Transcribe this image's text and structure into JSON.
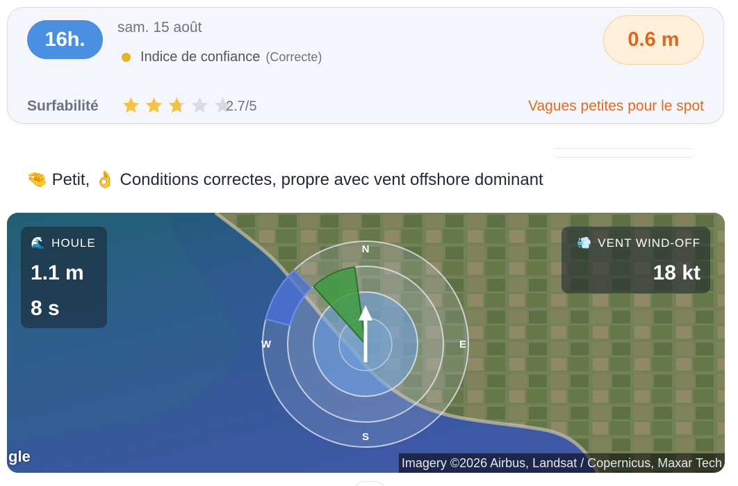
{
  "forecast": {
    "hour": "16h.",
    "date": "sam. 15 août",
    "confidence_label": "Indice de confiance",
    "confidence_level": "(Correcte)",
    "wave_height": "0.6 m",
    "surfability_label": "Surfabilité",
    "surfability_rating": 2.7,
    "surfability_score": "2.7/5",
    "warning": "Vagues petites pour le spot"
  },
  "summary": {
    "emoji_size": "🤏",
    "size_text": "Petit,",
    "emoji_quality": "👌",
    "conditions_text": "Conditions correctes, propre avec vent offshore dominant"
  },
  "map": {
    "swell": {
      "icon": "wave-icon",
      "emoji": "🌊",
      "label": "HOULE",
      "height": "1.1 m",
      "period": "8 s",
      "direction_deg": 300
    },
    "wind": {
      "icon": "wind-icon",
      "emoji": "💨",
      "label": "VENT WIND-OFF",
      "speed": "18 kt",
      "direction_deg": 335
    },
    "compass": {
      "north": "N",
      "east": "E",
      "south": "S",
      "west": "W"
    },
    "google_mark": "gle",
    "attribution": "Imagery ©2026 Airbus, Landsat / Copernicus, Maxar Tech"
  },
  "colors": {
    "hour_pill": "#4a90e2",
    "height_text": "#e0661c",
    "height_pill_bg": "#fdefd9",
    "warning": "#de6a24",
    "confidence_dot": "#e8b228",
    "star_filled": "#f5c242",
    "star_empty": "#d9dbe1",
    "swell_sector": "#4a6fd8",
    "wind_sector": "#3f9b3f"
  }
}
